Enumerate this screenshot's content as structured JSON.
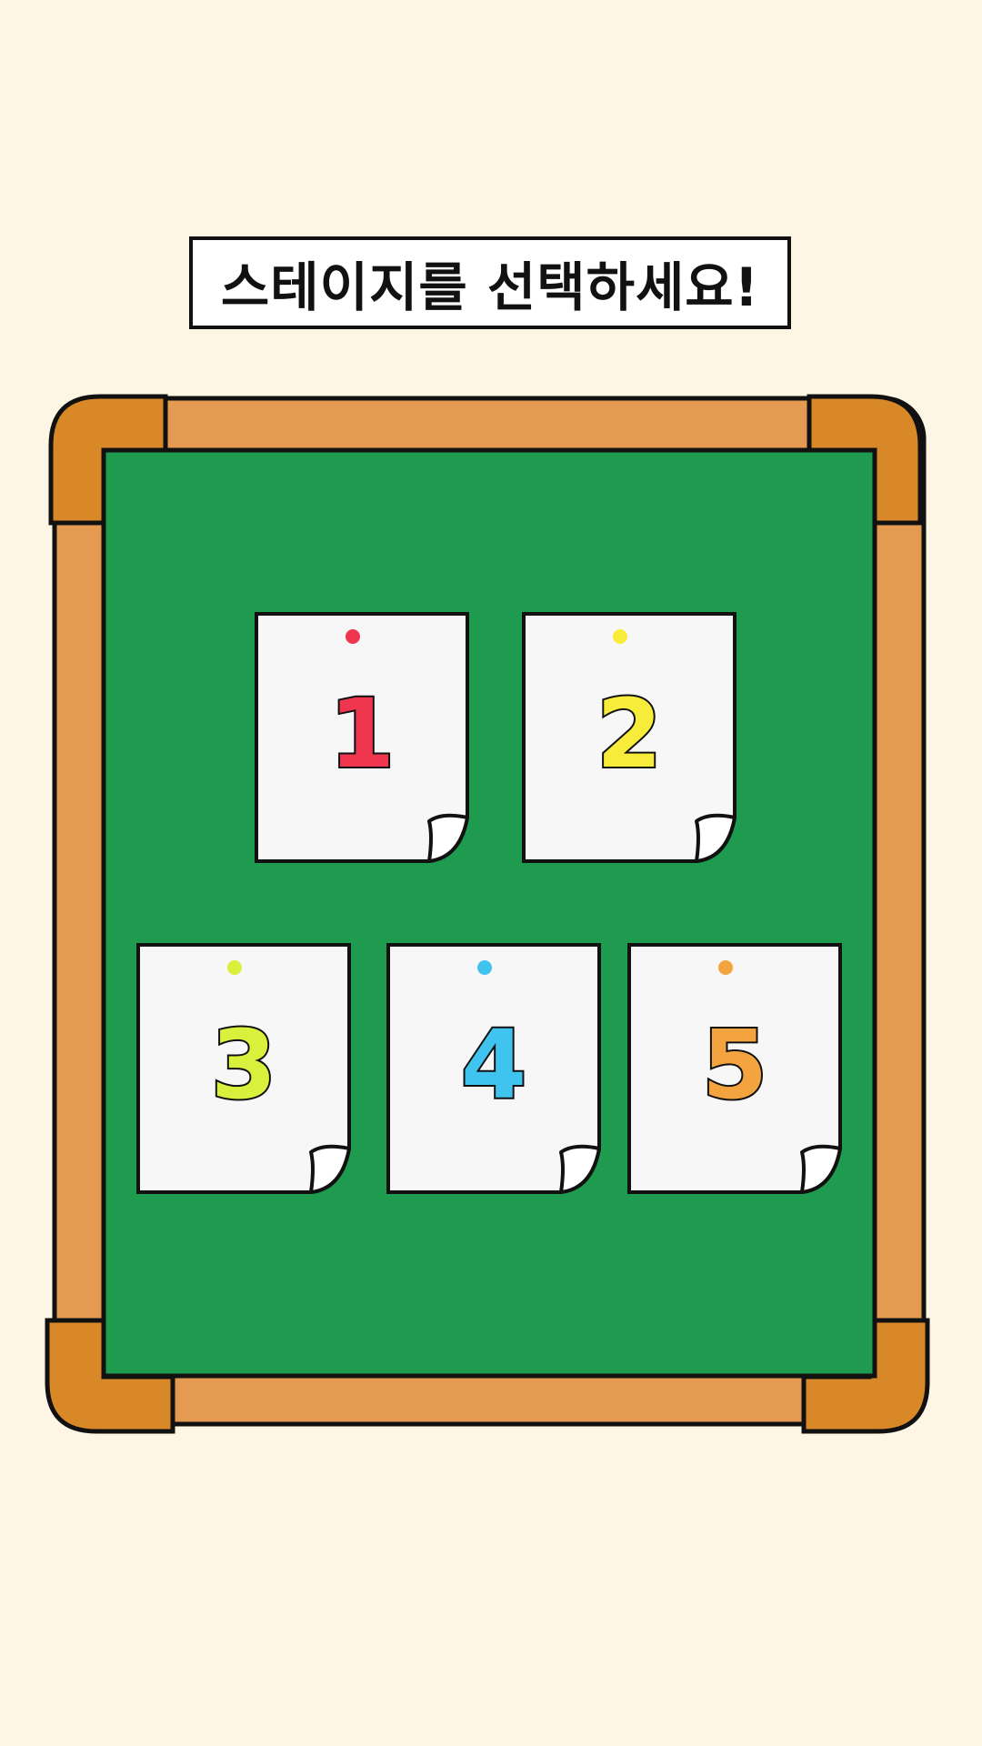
{
  "title": "스테이지를 선택하세요!",
  "colors": {
    "background": "#fdf6e4",
    "frame": "#e59a52",
    "frame_corner": "#d98827",
    "board": "#1e9b4e",
    "paper": "#f7f7f7",
    "outline": "#111111"
  },
  "stages": [
    {
      "label": "1",
      "color": "#f0364f",
      "pin_color": "#f0364f"
    },
    {
      "label": "2",
      "color": "#f7ec3a",
      "pin_color": "#f7ec3a"
    },
    {
      "label": "3",
      "color": "#d9f03c",
      "pin_color": "#d9f03c"
    },
    {
      "label": "4",
      "color": "#3fc4ef",
      "pin_color": "#3fc4ef"
    },
    {
      "label": "5",
      "color": "#f4a43e",
      "pin_color": "#f4a43e"
    }
  ]
}
